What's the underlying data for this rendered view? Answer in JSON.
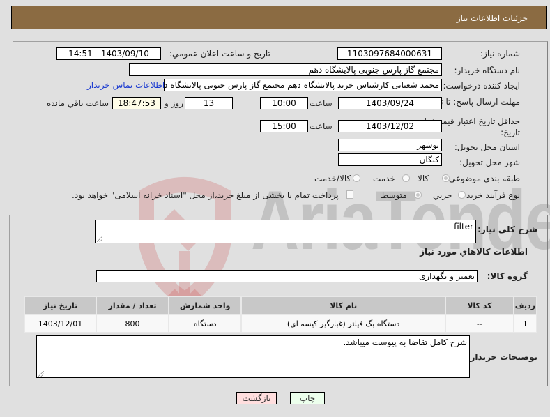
{
  "header": {
    "title": "جزئیات اطلاعات نیاز"
  },
  "need_number": {
    "label": "شماره نیاز:",
    "value": "1103097684000631"
  },
  "announce_datetime": {
    "label": "تاریخ و ساعت اعلان عمومي:",
    "value": "1403/09/10 - 14:51"
  },
  "buyer_org": {
    "label": "نام دستگاه خریدار:",
    "value": "مجتمع گاز پارس جنوبی  پالایشگاه دهم"
  },
  "requester": {
    "label": "ایجاد کننده درخواست:",
    "value": "محمد شعبانی کارشناس خرید پالایشگاه دهم  مجتمع گاز پارس جنوبی  پالایشگاه دهم",
    "contact_link": "اطلاعات تماس خریدار"
  },
  "response_deadline": {
    "label": "مهلت ارسال پاسخ: تا تاریخ:",
    "date": "1403/09/24",
    "time_label": "ساعت",
    "time": "10:00",
    "days": "13",
    "days_label": "روز و",
    "remaining": "18:47:53",
    "remaining_label": "ساعت باقي مانده"
  },
  "price_validity": {
    "label": "حداقل تاریخ اعتبار قیمت: تا تاریخ:",
    "date": "1403/12/02",
    "time_label": "ساعت",
    "time": "15:00"
  },
  "delivery_province": {
    "label": "استان محل تحویل:",
    "value": "بوشهر"
  },
  "delivery_city": {
    "label": "شهر محل تحویل:",
    "value": "کنگان"
  },
  "category": {
    "label": "طبقه بندی موضوعی:",
    "options": [
      "کالا",
      "خدمت",
      "کالا/خدمت"
    ],
    "selected": "کالا"
  },
  "purchase_process": {
    "label": "نوع فرآیند خرید :",
    "options": [
      "جزیي",
      "متوسط"
    ],
    "selected": "متوسط",
    "treasury_checkbox_label": "پرداخت تمام یا بخشی از مبلغ خرید،از محل \"اسناد خزانه اسلامی\" خواهد بود.",
    "treasury_checked": false
  },
  "general_description": {
    "label": "شرح كلي نياز:",
    "value": "filter"
  },
  "goods_section_title": "اطلاعات كالاهاي مورد نياز",
  "goods_group": {
    "label": "گروه کالا:",
    "value": "تعمیر و نگهداری"
  },
  "items_table": {
    "columns": [
      "ردیف",
      "کد کالا",
      "نام کالا",
      "واحد شمارش",
      "تعداد / مقدار",
      "تاریخ نیاز"
    ],
    "rows": [
      [
        "1",
        "--",
        "دستگاه بگ فیلتر (غبارگیر کیسه ای)",
        "دستگاه",
        "800",
        "1403/12/01"
      ]
    ]
  },
  "buyer_notes": {
    "label": "توضیحات خریدار:",
    "value": "شرح کامل تقاضا به پیوست میباشد."
  },
  "buttons": {
    "print": "چاپ",
    "back": "بازگشت"
  },
  "watermark": "AriaTender.neT"
}
